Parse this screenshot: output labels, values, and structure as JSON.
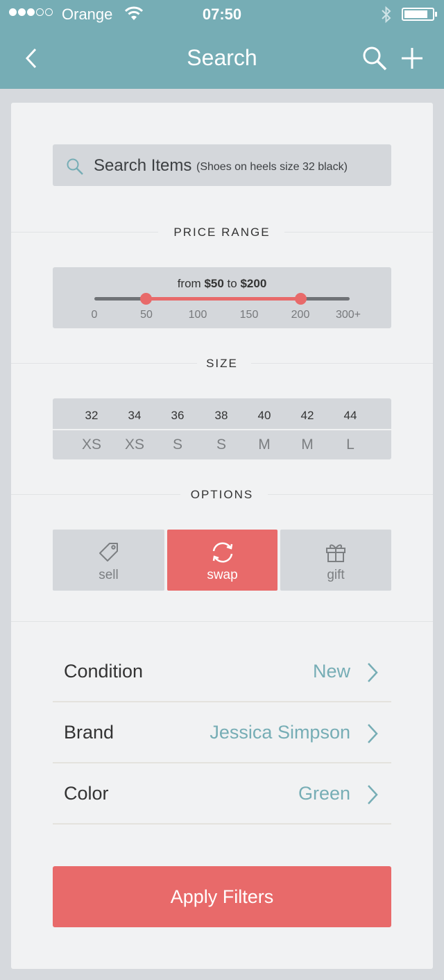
{
  "status_bar": {
    "carrier": "Orange",
    "time": "07:50",
    "signal_strength": 3,
    "signal_max": 5
  },
  "nav": {
    "title": "Search",
    "back_icon": "chevron-left-icon",
    "search_icon": "search-icon",
    "add_icon": "plus-icon"
  },
  "search": {
    "placeholder": "Search Items",
    "hint": "(Shoes on heels size 32 black)"
  },
  "price": {
    "section_label": "PRICE RANGE",
    "from_prefix": "from",
    "min_value": "$50",
    "conjunction": "to",
    "max_value": "$200",
    "ticks": [
      "0",
      "50",
      "100",
      "150",
      "200",
      "300+"
    ],
    "range_low": 50,
    "range_high": 200
  },
  "size": {
    "section_label": "SIZE",
    "columns": [
      {
        "num": "32",
        "letter": "XS"
      },
      {
        "num": "34",
        "letter": "XS"
      },
      {
        "num": "36",
        "letter": "S"
      },
      {
        "num": "38",
        "letter": "S"
      },
      {
        "num": "40",
        "letter": "M"
      },
      {
        "num": "42",
        "letter": "M"
      },
      {
        "num": "44",
        "letter": "L"
      }
    ],
    "selected_index": 3
  },
  "options": {
    "section_label": "OPTIONS",
    "items": [
      {
        "label": "sell",
        "icon": "tag-icon",
        "selected": false
      },
      {
        "label": "swap",
        "icon": "swap-icon",
        "selected": true
      },
      {
        "label": "gift",
        "icon": "gift-icon",
        "selected": false
      }
    ]
  },
  "filters": [
    {
      "label": "Condition",
      "value": "New"
    },
    {
      "label": "Brand",
      "value": "Jessica Simpson"
    },
    {
      "label": "Color",
      "value": "Green"
    }
  ],
  "apply_label": "Apply Filters",
  "colors": {
    "accent": "#76adb5",
    "primary": "#e86a6a",
    "panel": "#d4d7db",
    "background": "#f1f2f3"
  }
}
